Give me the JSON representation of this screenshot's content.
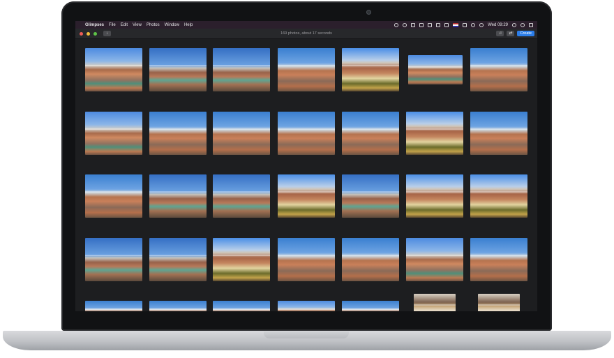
{
  "menubar": {
    "apple": "",
    "app_name": "Glimpses",
    "menus": [
      "File",
      "Edit",
      "View",
      "Photos",
      "Window",
      "Help"
    ],
    "clock": "Wed 09:29"
  },
  "toolbar": {
    "status": "169 photos, about 17 seconds",
    "create_label": "Create",
    "download_icon": "download-icon",
    "music_icon": "music-icon",
    "shuffle_icon": "shuffle-icon"
  }
}
